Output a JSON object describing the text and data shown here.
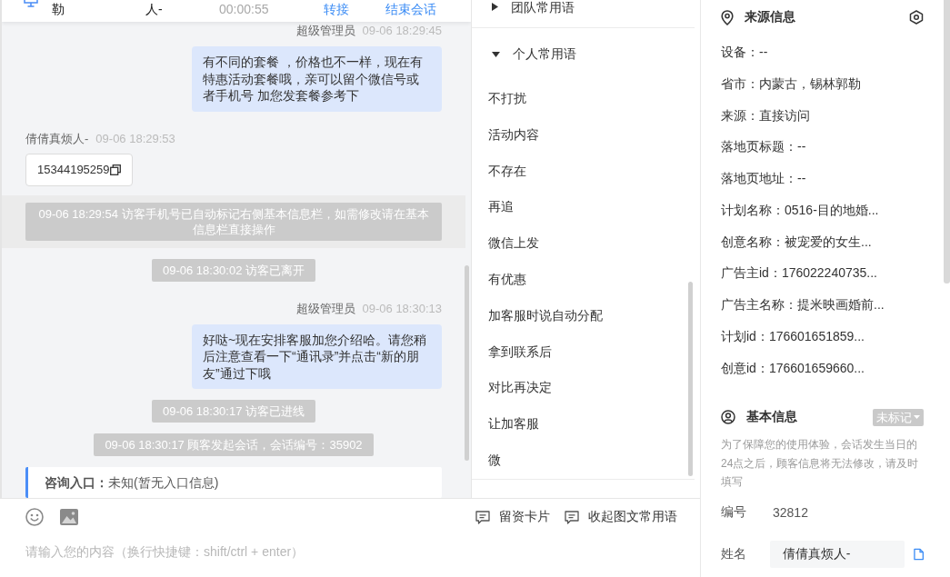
{
  "header": {
    "cells": [
      {
        "text": "勒"
      },
      {
        "text": "人-"
      }
    ],
    "duration": "00:00:55",
    "actions": [
      {
        "label": "转接"
      },
      {
        "label": "结束会话"
      }
    ]
  },
  "messages": [
    {
      "kind": "agent",
      "sender": "超级管理员",
      "time": "09-06 18:29:45",
      "text": "有不同的套餐 ，价格也不一样，现在有特惠活动套餐哦，亲可以留个微信号或者手机号 加您发套餐参考下"
    },
    {
      "kind": "visitor",
      "sender": "倩倩真烦人-",
      "time": "09-06 18:29:53",
      "text": "15344195259"
    },
    {
      "kind": "notice",
      "highlighted": true,
      "text": "09-06 18:29:54 访客手机号已自动标记右侧基本信息栏，如需修改请在基本信息栏直接操作"
    },
    {
      "kind": "notice",
      "highlighted": false,
      "text": "09-06 18:30:02 访客已离开"
    },
    {
      "kind": "agent",
      "sender": "超级管理员",
      "time": "09-06 18:30:13",
      "text": "好哒~现在安排客服加您介绍哈。请您稍后注意查看一下“通讯录”并点击“新的朋友”通过下哦"
    },
    {
      "kind": "notice",
      "highlighted": false,
      "text": "09-06 18:30:17 访客已进线"
    },
    {
      "kind": "notice",
      "highlighted": false,
      "text": "09-06 18:30:17 顾客发起会话，会话编号：35902"
    },
    {
      "kind": "entry",
      "text": "**咨询入口：**未知(暂无入口信息)"
    }
  ],
  "composer": {
    "actions": [
      {
        "label": "留资卡片"
      },
      {
        "label": "收起图文常用语"
      }
    ],
    "placeholder": "请输入您的内容（换行快捷键：shift/ctrl + enter）"
  },
  "phrases": {
    "groups": [
      {
        "title": "团队常用语",
        "expanded": false
      },
      {
        "title": "个人常用语",
        "expanded": true,
        "items": [
          "不打扰",
          "活动内容",
          "不存在",
          "再追",
          "微信上发",
          "有优惠",
          "加客服时说自动分配",
          "拿到联系后",
          "对比再决定",
          "让加客服",
          "微"
        ]
      }
    ]
  },
  "source_info": {
    "title": "来源信息",
    "rows": [
      "设备：--",
      "省市：内蒙古，锡林郭勒",
      "来源：直接访问",
      "落地页标题：--",
      "落地页地址：--",
      "计划名称：0516-目的地婚...",
      "创意名称：被宠爱的女生...",
      "广告主id：176022240735...",
      "广告主名称：提米映画婚前...",
      "计划id：176601651859...",
      "创意id：176601659660..."
    ]
  },
  "basic_info": {
    "title": "基本信息",
    "tag": "未标记",
    "notice": "为了保障您的使用体验，会话发生当日的24点之后，顾客信息将无法修改，请及时填写",
    "fields": [
      {
        "kind": "text",
        "label": "编号",
        "value": "32812"
      },
      {
        "kind": "input",
        "label": "姓名",
        "value": "倩倩真烦人-"
      }
    ]
  }
}
